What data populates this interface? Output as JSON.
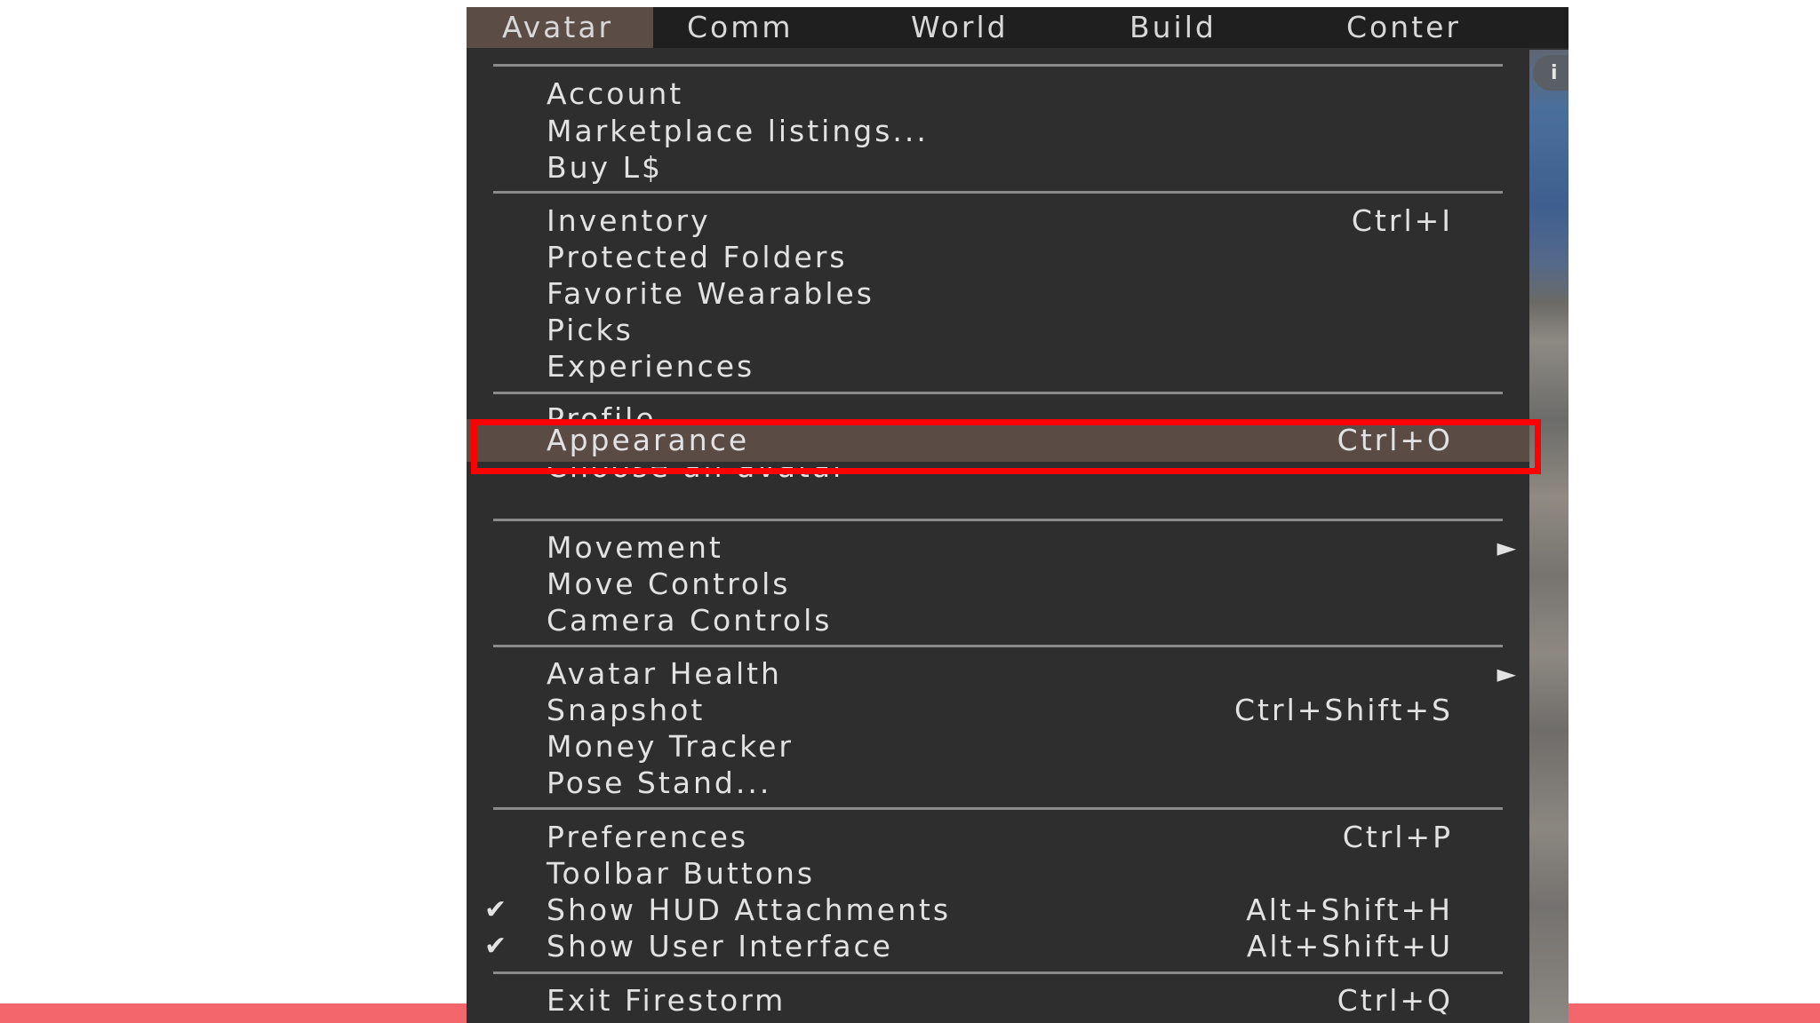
{
  "menubar": {
    "items": [
      {
        "label": "Avatar"
      },
      {
        "label": "Comm"
      },
      {
        "label": "World"
      },
      {
        "label": "Build"
      },
      {
        "label": "Conter"
      }
    ]
  },
  "world_view": {
    "button_glyph": "i"
  },
  "menu": {
    "account": "Account",
    "marketplace": "Marketplace listings...",
    "buy": "Buy L$",
    "inventory": {
      "label": "Inventory",
      "shortcut": "Ctrl+I"
    },
    "protected": "Protected Folders",
    "favorites": "Favorite Wearables",
    "picks": "Picks",
    "experiences": "Experiences",
    "profile": "Profile",
    "appearance": {
      "label": "Appearance",
      "shortcut": "Ctrl+O"
    },
    "choose_avatar": "Choose an avatar",
    "movement": "Movement",
    "move_controls": "Move Controls",
    "camera_controls": "Camera Controls",
    "avatar_health": "Avatar Health",
    "snapshot": {
      "label": "Snapshot",
      "shortcut": "Ctrl+Shift+S"
    },
    "money_tracker": "Money Tracker",
    "pose_stand": "Pose Stand...",
    "preferences": {
      "label": "Preferences",
      "shortcut": "Ctrl+P"
    },
    "toolbar_buttons": "Toolbar Buttons",
    "show_hud": {
      "label": "Show HUD Attachments",
      "shortcut": "Alt+Shift+H",
      "checked": true
    },
    "show_ui": {
      "label": "Show User Interface",
      "shortcut": "Alt+Shift+U",
      "checked": true
    },
    "exit": {
      "label": "Exit Firestorm",
      "shortcut": "Ctrl+Q"
    }
  },
  "glyphs": {
    "check": "✔",
    "submenu_arrow": "►"
  },
  "colors": {
    "menu_bg": "#2e2e2e",
    "menubar_bg": "#1f1f1f",
    "selected_bg": "#5b4b45",
    "annotation_box": "#ff0000",
    "bottom_bar": "#f2666c"
  }
}
